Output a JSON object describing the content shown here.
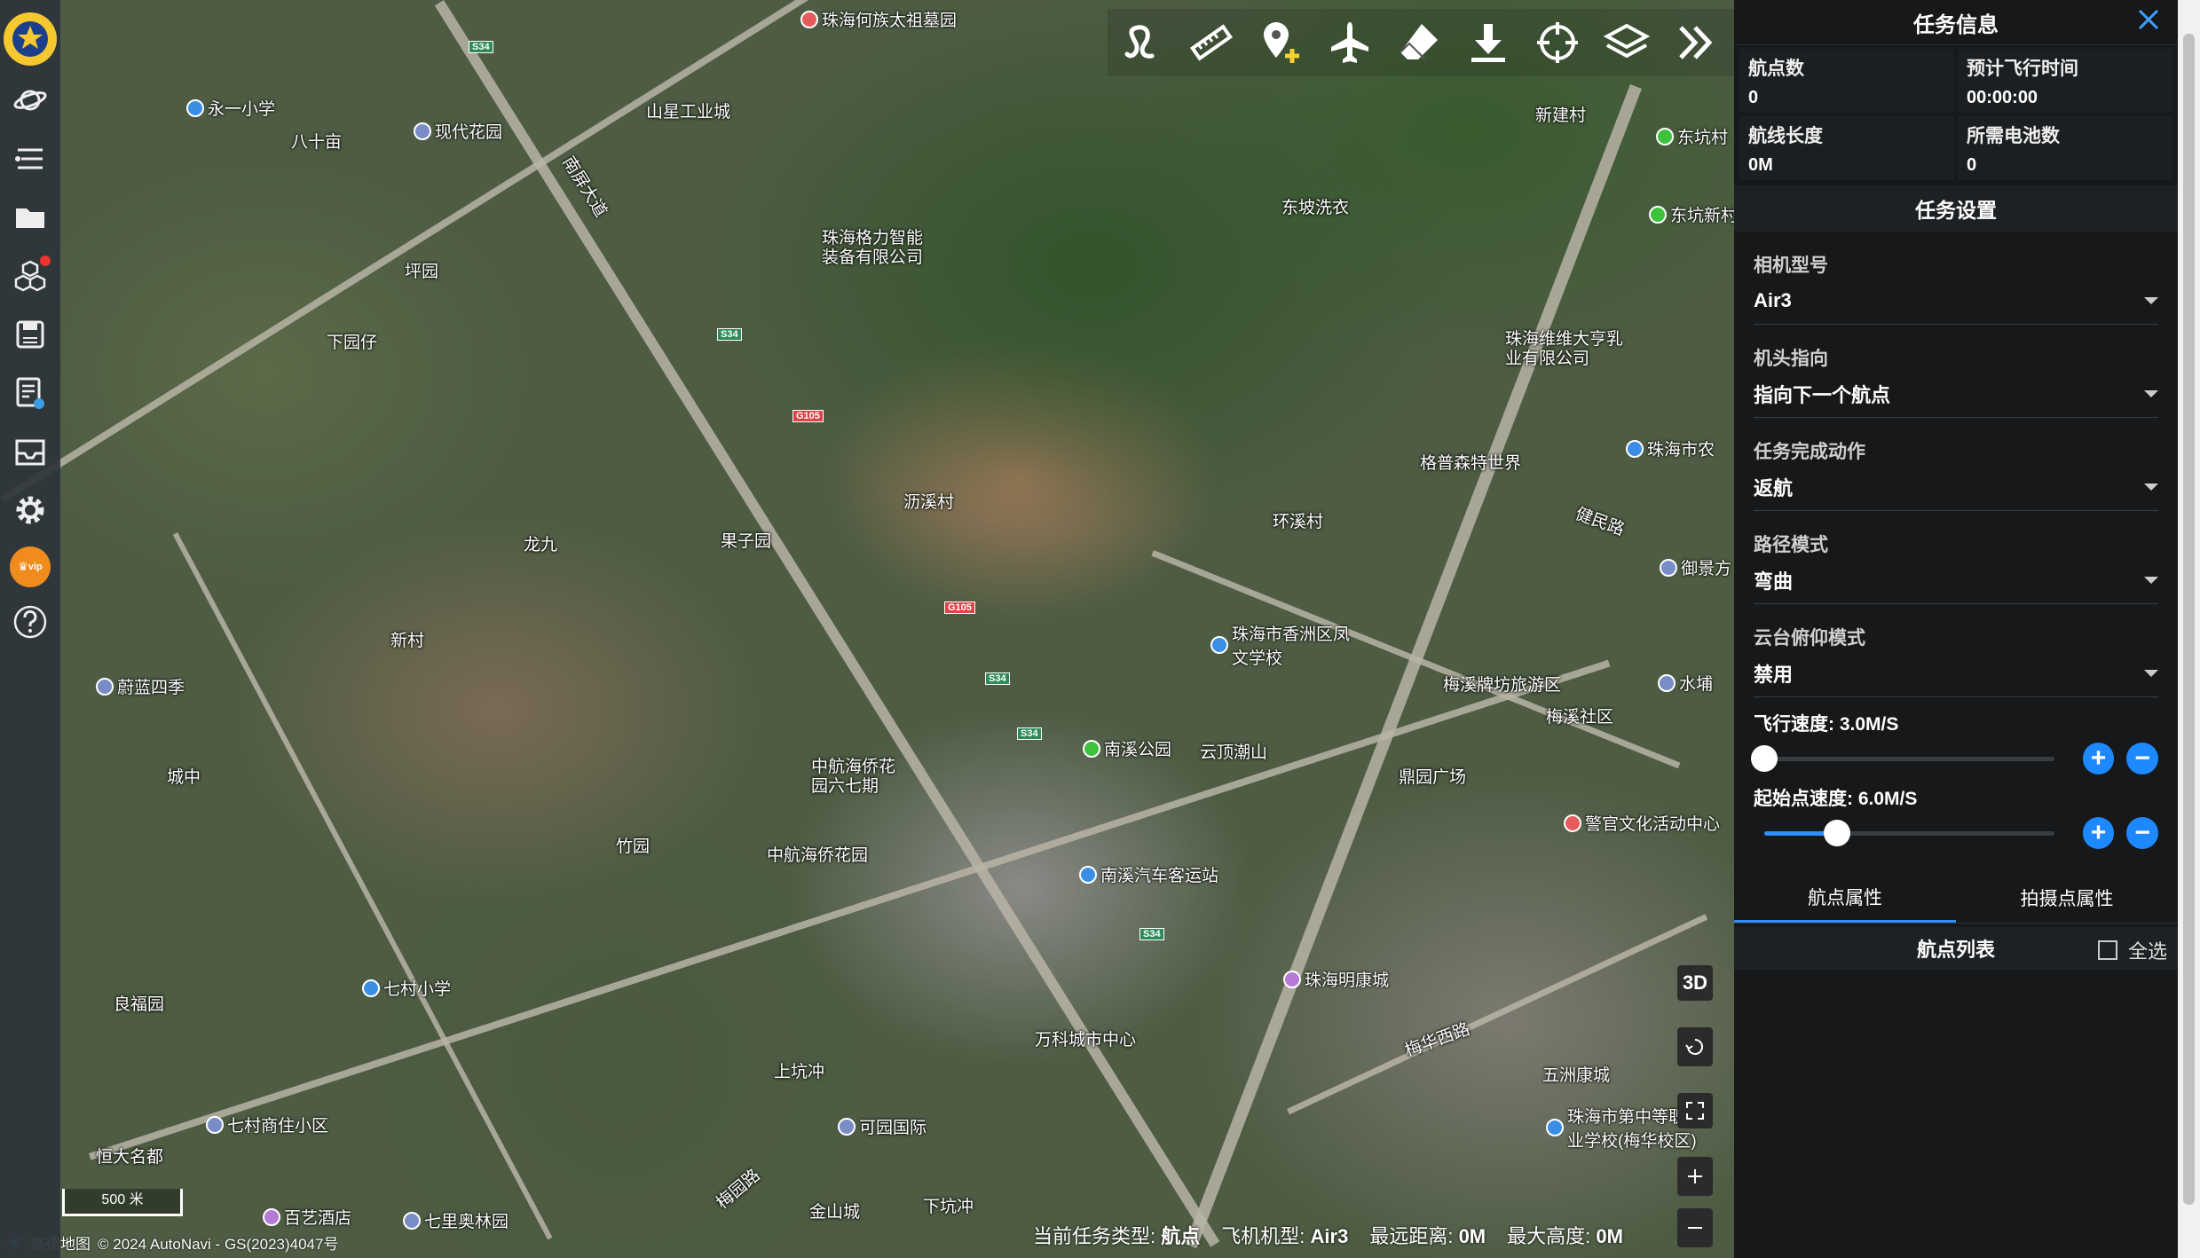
{
  "toolbar": {
    "buttons": [
      "draw-route",
      "measure-ruler",
      "add-waypoint",
      "airplane",
      "eraser",
      "download",
      "target",
      "layers",
      "expand"
    ]
  },
  "sidebar": {
    "vip_label": "vip"
  },
  "map": {
    "labels": [
      "珠海何族太祖墓园",
      "永一小学",
      "现代花园",
      "山星工业城",
      "八十亩",
      "珠海格力智能装备有限公司",
      "东坡洗衣",
      "新建村",
      "东坑村",
      "东坑新村",
      "坪园",
      "下园仔",
      "珠海维维大亨乳业有限公司",
      "格普森特世界",
      "沥溪村",
      "环溪村",
      "珠海市农",
      "健民路",
      "龙九",
      "果子园",
      "新村",
      "蔚蓝四季",
      "珠海市香洲区凤文学校",
      "御景方",
      "水埔",
      "城中",
      "南溪公园",
      "云顶潮山",
      "梅溪牌坊旅游区",
      "梅溪社区",
      "中航海侨花园六七期",
      "鼎园广场",
      "警官文化活动中心",
      "中航海侨花园",
      "竹园",
      "南溪汽车客运站",
      "七村小学",
      "珠海明康城",
      "良福园",
      "万科城市中心",
      "梅华西路",
      "五洲康城",
      "珠海市第中等职业学校(梅华校区)",
      "上坑冲",
      "七村商住小区",
      "恒大名都",
      "百艺酒店",
      "七里奥林园",
      "金山城",
      "下坑冲",
      "可园国际",
      "梅园路",
      "南屏大道"
    ],
    "scale": "500 米",
    "copyright": "© 2024 AutoNavi - GS(2023)4047号",
    "provider": "高德地图",
    "btn_3d": "3D"
  },
  "status": {
    "task_type_label": "当前任务类型:",
    "task_type_value": "航点",
    "aircraft_label": "飞机机型:",
    "aircraft_value": "Air3",
    "distance_label": "最远距离:",
    "distance_value": "0M",
    "height_label": "最大高度:",
    "height_value": "0M"
  },
  "panel": {
    "title": "任务信息",
    "info": [
      {
        "k": "航点数",
        "v": "0"
      },
      {
        "k": "预计飞行时间",
        "v": "00:00:00"
      },
      {
        "k": "航线长度",
        "v": "0M"
      },
      {
        "k": "所需电池数",
        "v": "0"
      }
    ],
    "settings_title": "任务设置",
    "fields": [
      {
        "label": "相机型号",
        "value": "Air3"
      },
      {
        "label": "机头指向",
        "value": "指向下一个航点"
      },
      {
        "label": "任务完成动作",
        "value": "返航"
      },
      {
        "label": "路径模式",
        "value": "弯曲"
      },
      {
        "label": "云台俯仰模式",
        "value": "禁用"
      }
    ],
    "speed_label": "飞行速度: 3.0M/S",
    "speed_fraction": 0.0,
    "start_speed_label": "起始点速度: 6.0M/S",
    "start_speed_fraction": 0.25,
    "plus": "+",
    "minus": "−",
    "tabs": [
      "航点属性",
      "拍摄点属性"
    ],
    "list_title": "航点列表",
    "select_all": "全选"
  }
}
